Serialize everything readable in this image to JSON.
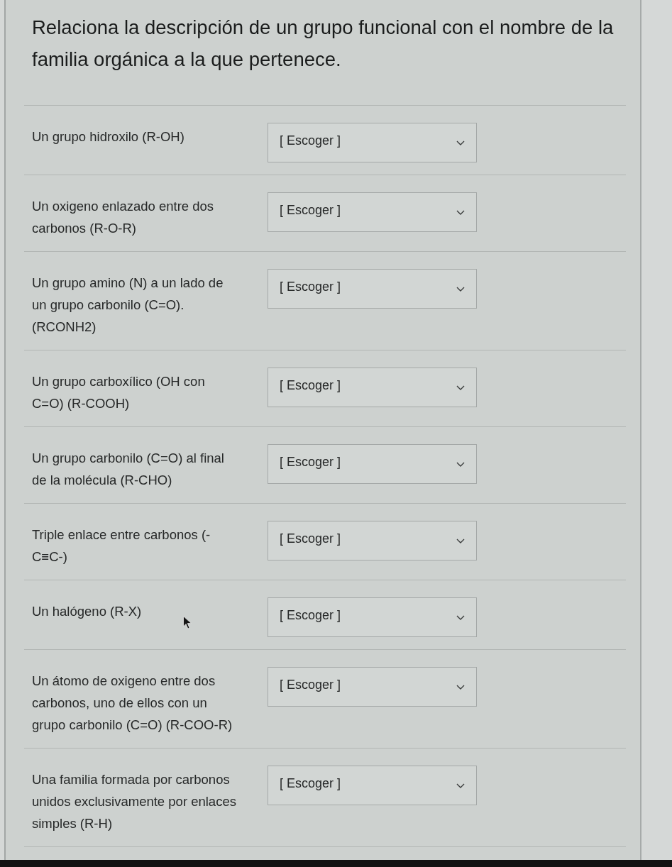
{
  "instructions": "Relaciona la descripción de un grupo funcional con el nombre de la familia orgánica a la que pertenece.",
  "questions": [
    {
      "prompt": "Un grupo hidroxilo (R-OH)",
      "answer": {
        "value": "[ Escoger ]"
      }
    },
    {
      "prompt": "Un oxigeno enlazado entre dos carbonos (R-O-R)",
      "answer": {
        "value": "[ Escoger ]"
      }
    },
    {
      "prompt": "Un grupo amino (N) a un lado de un grupo carbonilo (C=O). (RCONH2)",
      "answer": {
        "value": "[ Escoger ]"
      }
    },
    {
      "prompt": "Un grupo carboxílico (OH con C=O) (R-COOH)",
      "answer": {
        "value": "[ Escoger ]"
      }
    },
    {
      "prompt": "Un grupo carbonilo (C=O) al final de la molécula (R-CHO)",
      "answer": {
        "value": "[ Escoger ]"
      }
    },
    {
      "prompt": "Triple enlace entre carbonos (-C≡C-)",
      "answer": {
        "value": "[ Escoger ]"
      }
    },
    {
      "prompt": "Un halógeno (R-X)",
      "answer": {
        "value": "[ Escoger ]"
      }
    },
    {
      "prompt": "Un átomo de oxigeno entre dos carbonos, uno de ellos con un grupo carbonilo (C=O) (R-COO-R)",
      "answer": {
        "value": "[ Escoger ]"
      }
    },
    {
      "prompt": "Una familia formada por carbonos unidos exclusivamente por enlaces simples (R-H)",
      "answer": {
        "value": "[ Escoger ]"
      }
    }
  ]
}
